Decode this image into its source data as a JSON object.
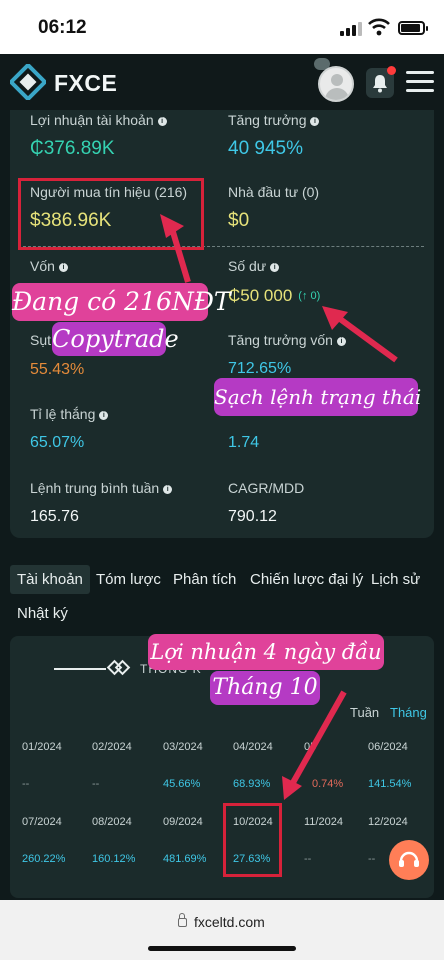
{
  "status_bar": {
    "time": "06:12"
  },
  "header": {
    "brand": "FXCE"
  },
  "stats": {
    "profit_label": "Lợi nhuận tài khoản",
    "profit_value": "₵376.89K",
    "growth_label": "Tăng trưởng",
    "growth_value": "40 945%",
    "signal_buyers_label": "Người mua tín hiệu (216)",
    "signal_buyers_value": "$386.96K",
    "investors_label": "Nhà đầu tư (0)",
    "investors_value": "$0",
    "capital_label": "Vốn",
    "balance_label": "Số dư",
    "balance_value": "₵50 000",
    "balance_badge": "(↑ 0)",
    "drawdown_label": "Sụt",
    "drawdown_value": "55.43%",
    "capital_growth_label": "Tăng trưởng vốn",
    "capital_growth_value": "712.65%",
    "win_rate_label": "Tỉ lệ thắng",
    "win_rate_value": "65.07%",
    "rr_value": "1.74",
    "weekly_orders_label": "Lệnh trung bình tuần",
    "weekly_orders_value": "165.76",
    "cagr_label": "CAGR/MDD",
    "cagr_value": "790.12"
  },
  "tabs": [
    "Tài khoản",
    "Tóm lược",
    "Phân tích",
    "Chiến lược đại lý",
    "Lịch sử",
    "Nhật ký"
  ],
  "monthly": {
    "title": "THỐNG K",
    "periods": [
      "Tuần",
      "Tháng"
    ],
    "active_period": "Tháng",
    "row1_months": [
      "01/2024",
      "02/2024",
      "03/2024",
      "04/2024",
      "05",
      "06/2024"
    ],
    "row1_values": [
      "--",
      "--",
      "45.66%",
      "68.93%",
      "0.74%",
      "141.54%"
    ],
    "row2_months": [
      "07/2024",
      "08/2024",
      "09/2024",
      "10/2024",
      "11/2024",
      "12/2024"
    ],
    "row2_values": [
      "260.22%",
      "160.12%",
      "481.69%",
      "27.63%",
      "--",
      "--"
    ]
  },
  "annotations": {
    "note1_line1": "Đang có 216NĐT",
    "note1_line2": "Copytrade",
    "note2": "Sạch lệnh trạng thái",
    "note3_line1": "Lợi nhuận 4 ngày đầu",
    "note3_line2": "Tháng 10"
  },
  "browser": {
    "url": "fxceltd.com"
  },
  "colors": {
    "accent": "#35d3b2",
    "highlight": "#d7223a",
    "note_pink": "#e0429a",
    "note_purple": "#b53ac4"
  }
}
